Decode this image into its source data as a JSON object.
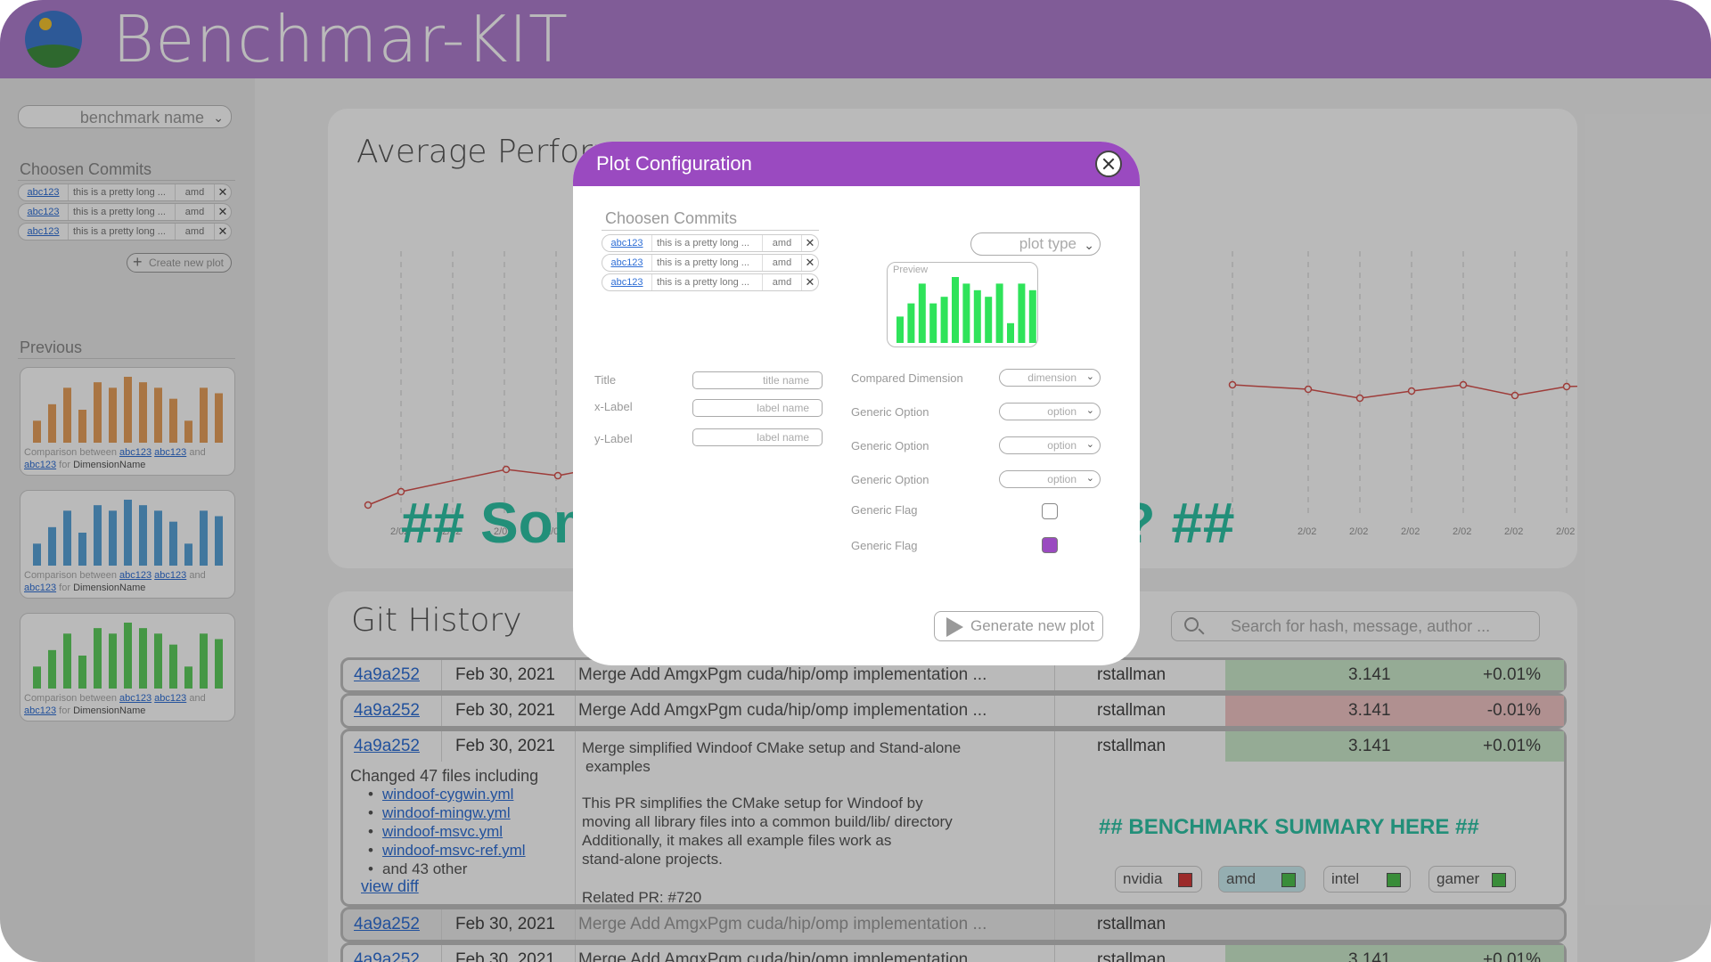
{
  "app": {
    "title": "Benchmar-KIT"
  },
  "sidebar": {
    "benchmark_select": "benchmark name",
    "chosen_commits_heading": "Choosen Commits",
    "chosen_commits": [
      {
        "hash": "abc123",
        "message": "this is a pretty long ...",
        "vendor": "amd"
      },
      {
        "hash": "abc123",
        "message": "this is a pretty long ...",
        "vendor": "amd"
      },
      {
        "hash": "abc123",
        "message": "this is a pretty long ...",
        "vendor": "amd"
      }
    ],
    "create_plot_label": "Create new plot",
    "previous_heading": "Previous",
    "previous_plots": [
      {
        "color": "#e8a15c",
        "values": [
          4,
          7,
          10,
          6,
          11,
          10,
          12,
          11,
          10,
          8,
          4,
          10,
          9
        ],
        "caption_prefix": "Comparison between",
        "link1": "abc123",
        "link2": "abc123",
        "and": "and",
        "link3": "abc123",
        "for": "for",
        "dimension": "DimensionName"
      },
      {
        "color": "#5aa3d9",
        "values": [
          4,
          7,
          10,
          6,
          11,
          10,
          12,
          11,
          10,
          8,
          4,
          10,
          9
        ],
        "caption_prefix": "Comparison between",
        "link1": "abc123",
        "link2": "abc123",
        "and": "and",
        "link3": "abc123",
        "for": "for",
        "dimension": "DimensionName"
      },
      {
        "color": "#5fcf5f",
        "values": [
          4,
          7,
          10,
          6,
          11,
          10,
          12,
          11,
          10,
          8,
          4,
          10,
          9
        ],
        "caption_prefix": "Comparison between",
        "link1": "abc123",
        "link2": "abc123",
        "and": "and",
        "link3": "abc123",
        "for": "for",
        "dimension": "DimensionName"
      }
    ]
  },
  "performance_card": {
    "title": "Average Performance",
    "placeholder": "## Some placeholder state? ##",
    "x_tick_label": "2/02"
  },
  "git_history": {
    "title": "Git History",
    "search_placeholder": "Search for hash, message, author ...",
    "rows": [
      {
        "hash": "4a9a252",
        "date": "Feb 30, 2021",
        "message": "Merge Add AmgxPgm cuda/hip/omp implementation ...",
        "author": "rstallman",
        "value": "3.141",
        "delta": "+0.01%",
        "status": "green"
      },
      {
        "hash": "4a9a252",
        "date": "Feb 30, 2021",
        "message": "Merge Add AmgxPgm cuda/hip/omp implementation ...",
        "author": "rstallman",
        "value": "3.141",
        "delta": "-0.01%",
        "status": "red"
      }
    ],
    "expanded": {
      "hash": "4a9a252",
      "date": "Feb 30, 2021",
      "title_line1": "Merge simplified Windoof CMake setup and Stand-alone",
      "title_line2": "examples",
      "author": "rstallman",
      "value": "3.141",
      "delta": "+0.01%",
      "changed_files_label": "Changed 47 files including",
      "files": [
        "windoof-cygwin.yml",
        "windoof-mingw.yml",
        "windoof-msvc.yml",
        "windoof-msvc-ref.yml"
      ],
      "more_files": "and 43 other",
      "view_diff": "view diff",
      "description": [
        "This PR simplifies the CMake setup for Windoof by",
        "moving all library files into a common build/lib/ directory",
        "Additionally, it makes all example files work as",
        "stand-alone projects."
      ],
      "related_pr": "Related PR: #720",
      "summary_placeholder": "## BENCHMARK SUMMARY HERE ##",
      "gpus": [
        {
          "name": "nvidia",
          "color": "#d63a3a"
        },
        {
          "name": "amd",
          "color": "#4fc24f"
        },
        {
          "name": "intel",
          "color": "#4fc24f"
        },
        {
          "name": "gamer",
          "color": "#4fc24f"
        }
      ]
    },
    "rows_after": [
      {
        "hash": "4a9a252",
        "date": "Feb 30, 2021",
        "message": "Merge Add AmgxPgm cuda/hip/omp implementation ...",
        "author": "rstallman",
        "value": "",
        "delta": ""
      },
      {
        "hash": "4a9a252",
        "date": "Feb 30, 2021",
        "message": "Merge Add AmgxPgm cuda/hip/omp implementation ...",
        "author": "rstallman",
        "value": "3.141",
        "delta": "+0.01%"
      }
    ]
  },
  "modal": {
    "title": "Plot Configuration",
    "chosen_commits_heading": "Choosen Commits",
    "commits": [
      {
        "hash": "abc123",
        "message": "this is a pretty long ...",
        "vendor": "amd"
      },
      {
        "hash": "abc123",
        "message": "this is a pretty long ...",
        "vendor": "amd"
      },
      {
        "hash": "abc123",
        "message": "this is a pretty long ...",
        "vendor": "amd"
      }
    ],
    "plot_type_select": "plot type",
    "preview_label": "Preview",
    "preview_color": "#2fe35a",
    "preview_values": [
      4,
      6,
      9,
      6,
      7,
      10,
      9,
      8,
      7,
      9,
      3,
      9,
      8
    ],
    "fields": [
      {
        "label": "Title",
        "placeholder": "title name"
      },
      {
        "label": "x-Label",
        "placeholder": "label name"
      },
      {
        "label": "y-Label",
        "placeholder": "label name"
      }
    ],
    "options": [
      {
        "label": "Compared Dimension",
        "value": "dimension"
      },
      {
        "label": "Generic Option",
        "value": "option"
      },
      {
        "label": "Generic Option",
        "value": "option"
      },
      {
        "label": "Generic Option",
        "value": "option"
      }
    ],
    "flags": [
      {
        "label": "Generic Flag",
        "checked": false
      },
      {
        "label": "Generic Flag",
        "checked": true
      }
    ],
    "generate_button": "Generate new plot"
  },
  "colors": {
    "header": "#b07fd0",
    "modal_header": "#9a4ac0",
    "accent": "#2fc4a7",
    "link": "#2f6fd6"
  }
}
